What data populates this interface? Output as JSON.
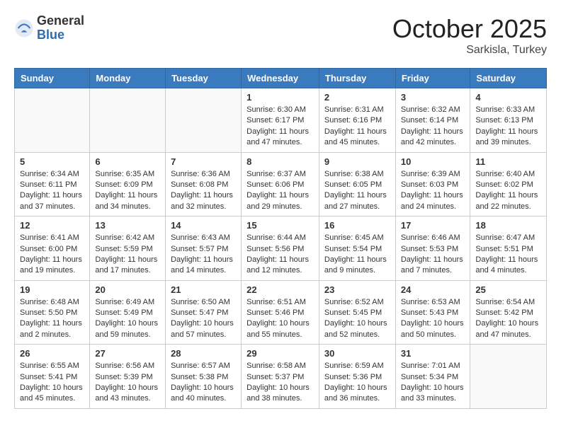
{
  "logo": {
    "general": "General",
    "blue": "Blue"
  },
  "header": {
    "month": "October 2025",
    "location": "Sarkisla, Turkey"
  },
  "weekdays": [
    "Sunday",
    "Monday",
    "Tuesday",
    "Wednesday",
    "Thursday",
    "Friday",
    "Saturday"
  ],
  "weeks": [
    [
      {
        "day": "",
        "info": ""
      },
      {
        "day": "",
        "info": ""
      },
      {
        "day": "",
        "info": ""
      },
      {
        "day": "1",
        "info": "Sunrise: 6:30 AM\nSunset: 6:17 PM\nDaylight: 11 hours and 47 minutes."
      },
      {
        "day": "2",
        "info": "Sunrise: 6:31 AM\nSunset: 6:16 PM\nDaylight: 11 hours and 45 minutes."
      },
      {
        "day": "3",
        "info": "Sunrise: 6:32 AM\nSunset: 6:14 PM\nDaylight: 11 hours and 42 minutes."
      },
      {
        "day": "4",
        "info": "Sunrise: 6:33 AM\nSunset: 6:13 PM\nDaylight: 11 hours and 39 minutes."
      }
    ],
    [
      {
        "day": "5",
        "info": "Sunrise: 6:34 AM\nSunset: 6:11 PM\nDaylight: 11 hours and 37 minutes."
      },
      {
        "day": "6",
        "info": "Sunrise: 6:35 AM\nSunset: 6:09 PM\nDaylight: 11 hours and 34 minutes."
      },
      {
        "day": "7",
        "info": "Sunrise: 6:36 AM\nSunset: 6:08 PM\nDaylight: 11 hours and 32 minutes."
      },
      {
        "day": "8",
        "info": "Sunrise: 6:37 AM\nSunset: 6:06 PM\nDaylight: 11 hours and 29 minutes."
      },
      {
        "day": "9",
        "info": "Sunrise: 6:38 AM\nSunset: 6:05 PM\nDaylight: 11 hours and 27 minutes."
      },
      {
        "day": "10",
        "info": "Sunrise: 6:39 AM\nSunset: 6:03 PM\nDaylight: 11 hours and 24 minutes."
      },
      {
        "day": "11",
        "info": "Sunrise: 6:40 AM\nSunset: 6:02 PM\nDaylight: 11 hours and 22 minutes."
      }
    ],
    [
      {
        "day": "12",
        "info": "Sunrise: 6:41 AM\nSunset: 6:00 PM\nDaylight: 11 hours and 19 minutes."
      },
      {
        "day": "13",
        "info": "Sunrise: 6:42 AM\nSunset: 5:59 PM\nDaylight: 11 hours and 17 minutes."
      },
      {
        "day": "14",
        "info": "Sunrise: 6:43 AM\nSunset: 5:57 PM\nDaylight: 11 hours and 14 minutes."
      },
      {
        "day": "15",
        "info": "Sunrise: 6:44 AM\nSunset: 5:56 PM\nDaylight: 11 hours and 12 minutes."
      },
      {
        "day": "16",
        "info": "Sunrise: 6:45 AM\nSunset: 5:54 PM\nDaylight: 11 hours and 9 minutes."
      },
      {
        "day": "17",
        "info": "Sunrise: 6:46 AM\nSunset: 5:53 PM\nDaylight: 11 hours and 7 minutes."
      },
      {
        "day": "18",
        "info": "Sunrise: 6:47 AM\nSunset: 5:51 PM\nDaylight: 11 hours and 4 minutes."
      }
    ],
    [
      {
        "day": "19",
        "info": "Sunrise: 6:48 AM\nSunset: 5:50 PM\nDaylight: 11 hours and 2 minutes."
      },
      {
        "day": "20",
        "info": "Sunrise: 6:49 AM\nSunset: 5:49 PM\nDaylight: 10 hours and 59 minutes."
      },
      {
        "day": "21",
        "info": "Sunrise: 6:50 AM\nSunset: 5:47 PM\nDaylight: 10 hours and 57 minutes."
      },
      {
        "day": "22",
        "info": "Sunrise: 6:51 AM\nSunset: 5:46 PM\nDaylight: 10 hours and 55 minutes."
      },
      {
        "day": "23",
        "info": "Sunrise: 6:52 AM\nSunset: 5:45 PM\nDaylight: 10 hours and 52 minutes."
      },
      {
        "day": "24",
        "info": "Sunrise: 6:53 AM\nSunset: 5:43 PM\nDaylight: 10 hours and 50 minutes."
      },
      {
        "day": "25",
        "info": "Sunrise: 6:54 AM\nSunset: 5:42 PM\nDaylight: 10 hours and 47 minutes."
      }
    ],
    [
      {
        "day": "26",
        "info": "Sunrise: 6:55 AM\nSunset: 5:41 PM\nDaylight: 10 hours and 45 minutes."
      },
      {
        "day": "27",
        "info": "Sunrise: 6:56 AM\nSunset: 5:39 PM\nDaylight: 10 hours and 43 minutes."
      },
      {
        "day": "28",
        "info": "Sunrise: 6:57 AM\nSunset: 5:38 PM\nDaylight: 10 hours and 40 minutes."
      },
      {
        "day": "29",
        "info": "Sunrise: 6:58 AM\nSunset: 5:37 PM\nDaylight: 10 hours and 38 minutes."
      },
      {
        "day": "30",
        "info": "Sunrise: 6:59 AM\nSunset: 5:36 PM\nDaylight: 10 hours and 36 minutes."
      },
      {
        "day": "31",
        "info": "Sunrise: 7:01 AM\nSunset: 5:34 PM\nDaylight: 10 hours and 33 minutes."
      },
      {
        "day": "",
        "info": ""
      }
    ]
  ]
}
